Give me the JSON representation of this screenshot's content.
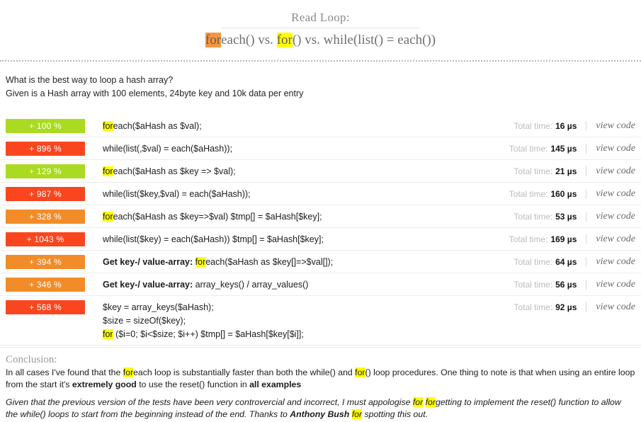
{
  "header": {
    "title": "Read Loop:",
    "subtitle_parts": [
      {
        "text": "for",
        "highlight": "orange"
      },
      {
        "text": "each() vs. ",
        "highlight": "none"
      },
      {
        "text": "for",
        "highlight": "yellow"
      },
      {
        "text": "() vs. while(list() = each())",
        "highlight": "none"
      }
    ],
    "subtitle_plain": "foreach() vs. for() vs. while(list() = each())"
  },
  "intro": {
    "line1": "What is the best way to loop a hash array?",
    "line2": "Given is a Hash array with 100 elements, 24byte key and 10k data per entry"
  },
  "labels": {
    "total_time": "Total time:",
    "view_code": "view code"
  },
  "colors": {
    "green": "#aada21",
    "red": "#f9461e",
    "orange": "#f18c28",
    "highlight_yellow": "#ffff00",
    "highlight_orange": "#f79640"
  },
  "rows": [
    {
      "percent": "+ 100 %",
      "color": "green",
      "code_html": "<span class=\"yh\">for</span>each($aHash as $val);",
      "time": "16 µs",
      "view_code": "view code"
    },
    {
      "percent": "+ 896 %",
      "color": "red",
      "code_html": "while(list(,$val) = each($aHash));",
      "time": "145 µs",
      "view_code": "view code"
    },
    {
      "percent": "+ 129 %",
      "color": "green",
      "code_html": "<span class=\"yh\">for</span>each($aHash as $key =&gt; $val);",
      "time": "21 µs",
      "view_code": "view code"
    },
    {
      "percent": "+ 987 %",
      "color": "red",
      "code_html": "while(list($key,$val) = each($aHash));",
      "time": "160 µs",
      "view_code": "view code"
    },
    {
      "percent": "+ 328 %",
      "color": "orange",
      "code_html": "<span class=\"yh\">for</span>each($aHash as $key=&gt;$val) $tmp[] = $aHash[$key];",
      "time": "53 µs",
      "view_code": "view code"
    },
    {
      "percent": "+ 1043 %",
      "color": "red",
      "code_html": "while(list($key) = each($aHash)) $tmp[] = $aHash[$key];",
      "time": "169 µs",
      "view_code": "view code"
    },
    {
      "percent": "+ 394 %",
      "color": "orange",
      "code_html": "<b>Get key-/ value-array:</b> <span class=\"yh\">for</span>each($aHash as $key[]=&gt;$val[]);",
      "time": "64 µs",
      "view_code": "view code"
    },
    {
      "percent": "+ 346 %",
      "color": "orange",
      "code_html": "<b>Get key-/ value-array:</b> array_keys() / array_values()",
      "time": "56 µs",
      "view_code": "view code"
    },
    {
      "percent": "+ 568 %",
      "color": "red",
      "code_html": "$key = array_keys($aHash);<br>$size = sizeOf($key);<br><span class=\"yh\">for</span> ($i=0; $i&lt;$size; $i++) $tmp[] = $aHash[$key[$i]];",
      "time": "92 µs",
      "view_code": "view code",
      "tall": true
    }
  ],
  "conclusion": {
    "title": "Conclusion:",
    "body_html": "In all cases I've found that the <span class=\"yh\">for</span>each loop is substantially faster than both the while() and <span class=\"yh\">for</span>() loop procedures. One thing to note is that when using an entire loop from the start it's <b>extremely good</b> to use the reset() function in <b>all examples</b>",
    "body_plain": "In all cases I've found that the foreach loop is substantially faster than both the while() and for() loop procedures. One thing to note is that when using an entire loop from the start it's extremely good to use the reset() function in all examples",
    "note_html": "Given that the previous version of the tests have been very controvercial and incorrect, I must appologise <span class=\"yh\">for</span> <span class=\"yh\">for</span>getting to implement the reset() function to allow the while() loops to start from the beginning instead of the end. Thanks to <b>Anthony Bush</b> <span class=\"yh\">for</span> spotting this out.",
    "note_plain": "Given that the previous version of the tests have been very controvercial and incorrect, I must appologise for forgetting to implement the reset() function to allow the while() loops to start from the beginning instead of the end. Thanks to Anthony Bush for spotting this out."
  }
}
